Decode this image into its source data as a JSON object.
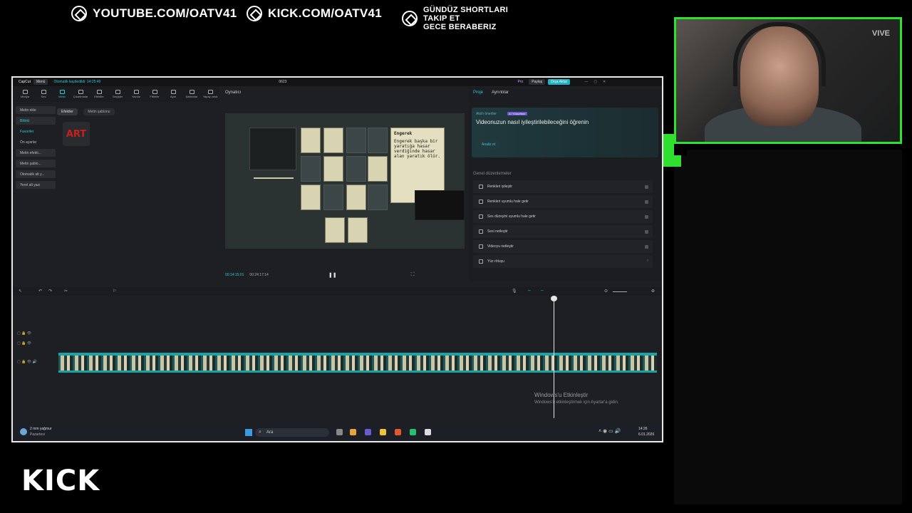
{
  "overlay": {
    "youtube": "YOUTUBE.COM/OATV41",
    "kick": "KICK.COM/OATV41",
    "shorts_line1": "GÜNDÜZ SHORTLARI",
    "shorts_line2": "TAKIP ET",
    "shorts_line3": "GECE BERABERIZ",
    "kick_logo": "KICK",
    "webcam_brand": "VIVE",
    "accent": "#2fe02f"
  },
  "app": {
    "title": "CapCut",
    "menu": "Menü",
    "autosave": "Otomatik kaydedildi: 14:25:49",
    "project": "0623",
    "pro": "Pro",
    "share": "Paylaş",
    "export": "Dışa Aktar",
    "toolbar": [
      "Medya",
      "Ses",
      "Metin",
      "Çıkartmalar",
      "Efektler",
      "Geçişler",
      "Yazılar",
      "Filtreler",
      "Ayar",
      "Şablonlar",
      "Yapay zekâ"
    ],
    "left_nav": [
      "Metin ekle",
      "Bilinki",
      "Favoriler",
      "Ön ayarlar",
      "Metin efekti...",
      "Metin şablo...",
      "Otomatik alt y...",
      "Yerel alt yazı"
    ],
    "media_tabs": [
      "Efektler",
      "Metin şablonu"
    ],
    "art_label": "ART",
    "player_title": "Oynatıcı",
    "time_current": "00:14:15:01",
    "time_total": "00:24:17:14",
    "right_tabs": [
      "Proje",
      "Ayrıntılar"
    ],
    "ai_small": "Akıllı öneriler",
    "ai_badge": "AI Yükseltme",
    "ai_title": "Videonuzun nasıl iyileştirilebileceğini öğrenin",
    "ai_button": "Analiz et",
    "general_title": "Genel düzenlemeler",
    "options": [
      "Renkleri iyileştir",
      "Renkleri uyumlu hale getir",
      "Ses düzeyini uyumlu hale getir",
      "Sesi netleştir",
      "Videoyu netleştir",
      "Yüz rötuşu"
    ],
    "game_desc": "Engerek başka bir yaratığa hasar verdiğinde hasar alan yaratık ölür.",
    "game_desc_title": "Engerek",
    "watermark_title": "Windows'u Etkinleştir",
    "watermark_sub": "Windows'u etkinleştirmek için Ayarlar'a gidin.",
    "taskbar": {
      "weather": "2 mm yağmur",
      "weather_sub": "Pazartesi",
      "search": "Ara",
      "clock": "14:26",
      "date": "6.01.2026"
    }
  }
}
